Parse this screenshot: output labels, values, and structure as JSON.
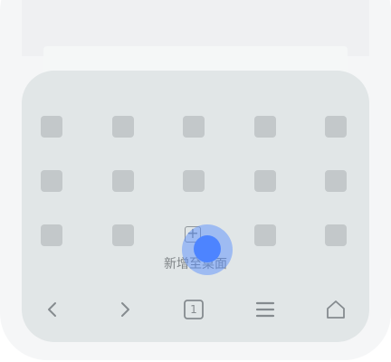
{
  "menu": {
    "add_to_home_label": "新增至桌面",
    "tile_rows": 3,
    "tile_columns": 5
  },
  "toolbar": {
    "back_icon": "chevron-left-icon",
    "forward_icon": "chevron-right-icon",
    "tabs_icon": "tabs-count-icon",
    "tabs_count": "1",
    "menu_icon": "menu-icon",
    "home_icon": "home-icon"
  },
  "colors": {
    "sheet_background": "#e1e6e7",
    "tile_color": "#c3c8ca",
    "touch_indicator": "#4d84ff"
  }
}
